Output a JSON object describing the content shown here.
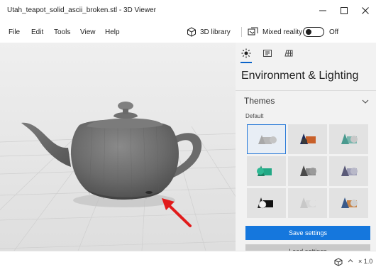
{
  "window": {
    "title": "Utah_teapot_solid_ascii_broken.stl - 3D Viewer"
  },
  "menu": {
    "items": [
      "File",
      "Edit",
      "Tools",
      "View",
      "Help"
    ],
    "library_label": "3D library",
    "mixed_reality_label": "Mixed reality",
    "mixed_reality_state": "Off"
  },
  "panel": {
    "title": "Environment & Lighting",
    "themes_label": "Themes",
    "default_label": "Default",
    "save_label": "Save settings",
    "reset_label": "Load settings"
  },
  "status": {
    "zoom": "× 1.0"
  },
  "colors": {
    "accent": "#1577dd",
    "arrow": "#e11b1b"
  }
}
